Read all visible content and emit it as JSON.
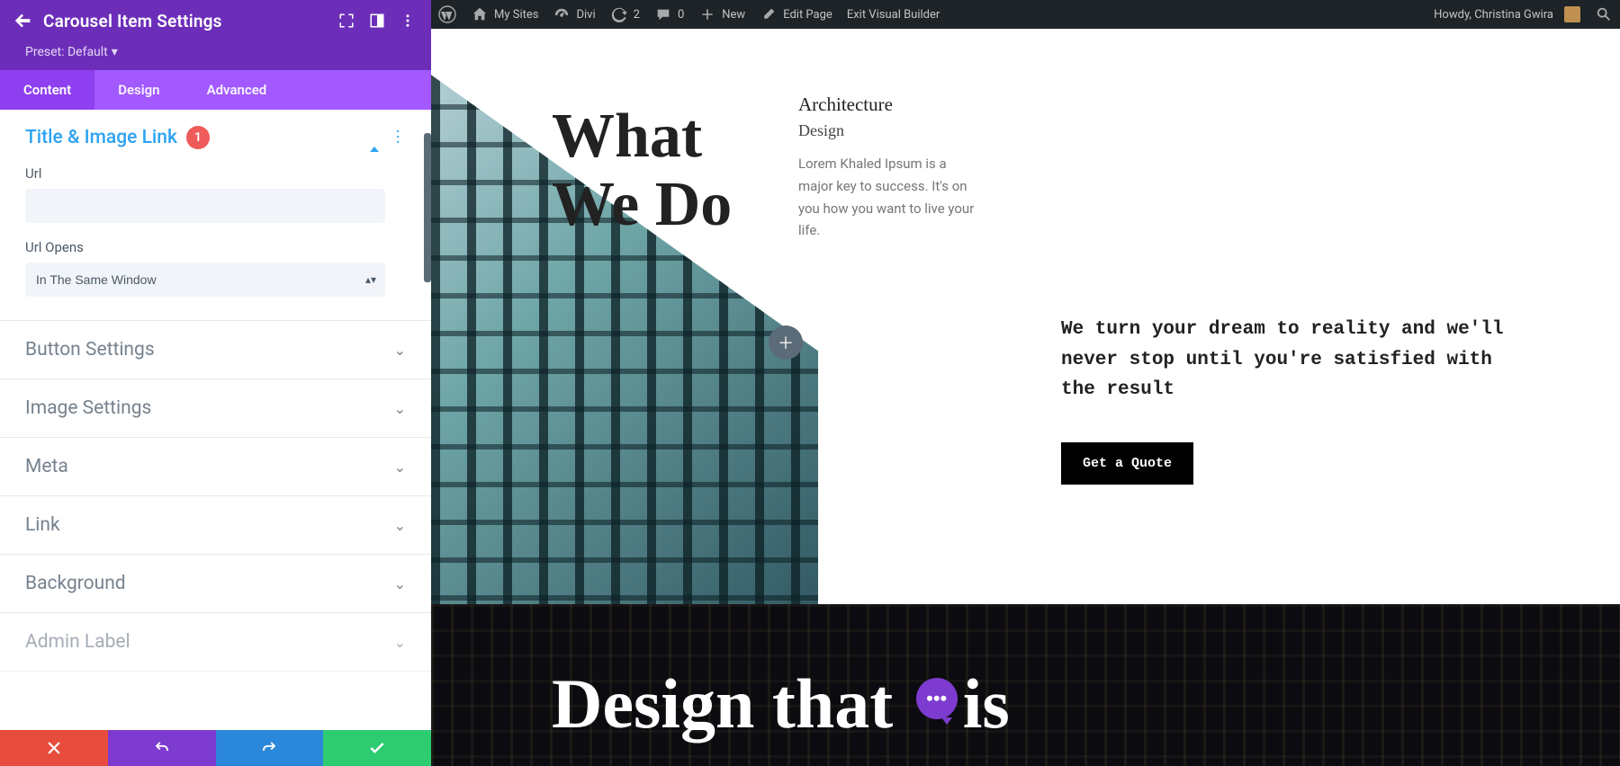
{
  "adminbar": {
    "mysites": "My Sites",
    "siteName": "Divi",
    "updates": "2",
    "comments": "0",
    "new": "New",
    "editPage": "Edit Page",
    "exitBuilder": "Exit Visual Builder",
    "greeting": "Howdy, Christina Gwira"
  },
  "panel": {
    "title": "Carousel Item Settings",
    "presetLabel": "Preset: Default",
    "tabs": {
      "content": "Content",
      "design": "Design",
      "advanced": "Advanced"
    },
    "titleImageLink": {
      "title": "Title & Image Link",
      "badge": "1",
      "url_label": "Url",
      "url_value": "",
      "urlopens_label": "Url Opens",
      "urlopens_value": "In The Same Window"
    },
    "closed": {
      "button": "Button Settings",
      "image": "Image Settings",
      "meta": "Meta",
      "link": "Link",
      "background": "Background",
      "adminlabel": "Admin Label"
    }
  },
  "page": {
    "whatWeDo_l1": "What",
    "whatWeDo_l2": "We Do",
    "card_title": "Architecture",
    "card_subtitle": "Design",
    "card_body": "Lorem Khaled Ipsum is a major key to success. It's on you how you want to live your life.",
    "pitch": "We turn your dream to reality and we'll never stop until you're satisfied with the result",
    "quoteBtn": "Get a Quote",
    "darkHeading_a": "Design that",
    "darkHeading_b": "is"
  }
}
